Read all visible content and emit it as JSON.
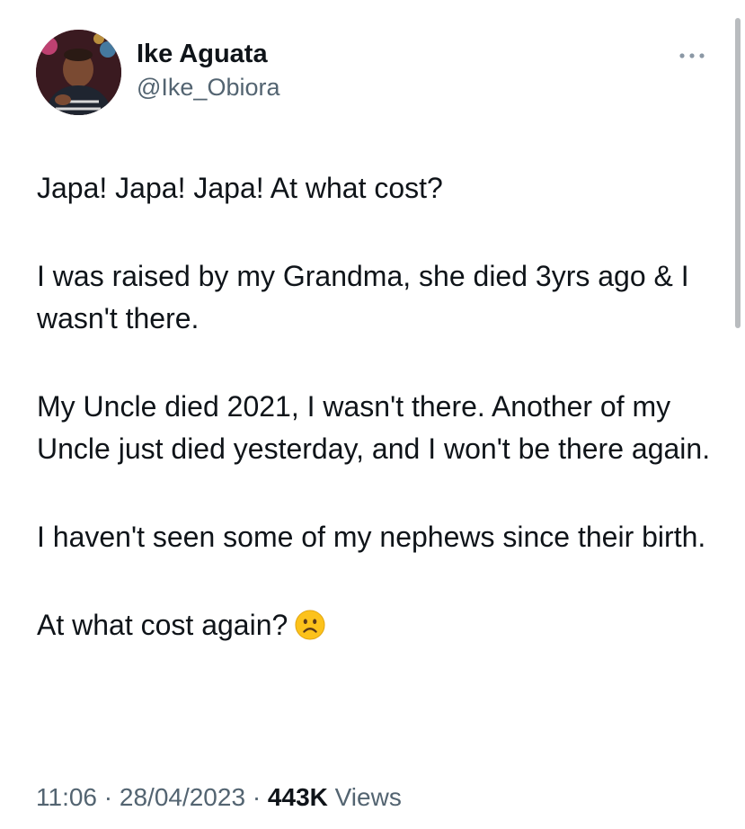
{
  "author": {
    "display_name": "Ike Aguata",
    "handle": "@Ike_Obiora",
    "avatar_icon": "profile-photo"
  },
  "more_icon": "more-horizontal-icon",
  "tweet": {
    "paragraphs": [
      "Japa! Japa! Japa! At what cost?",
      "I was raised by my Grandma, she died 3yrs ago & I wasn't there.",
      "My Uncle died 2021, I wasn't there. Another of my Uncle just died yesterday, and I won't be there again.",
      "I haven't seen some of my nephews since their birth.",
      "At what cost again?"
    ],
    "emoji": "frowning-face-emoji"
  },
  "meta": {
    "time": "11:06",
    "separator": "·",
    "date": "28/04/2023",
    "views_count": "443K",
    "views_label": "Views"
  },
  "colors": {
    "text_primary": "#0f1419",
    "text_secondary": "#536471",
    "background": "#ffffff",
    "emoji_face": "#fcc21b"
  }
}
